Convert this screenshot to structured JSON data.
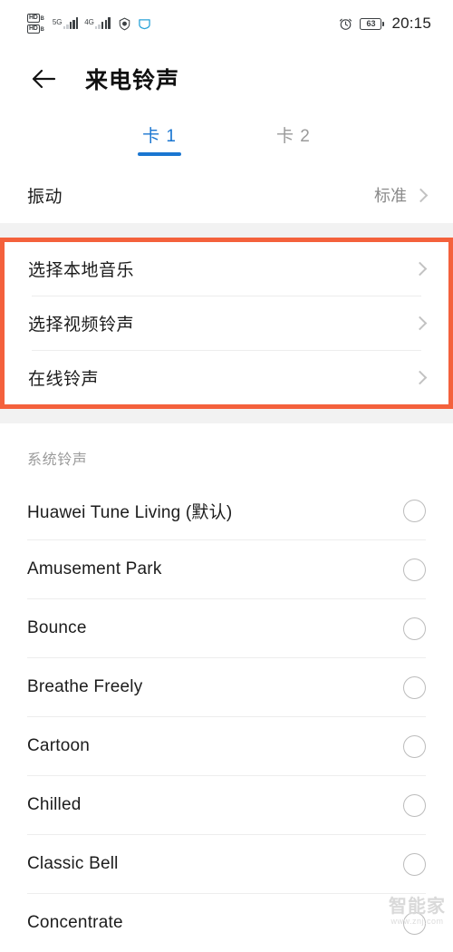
{
  "status_bar": {
    "hd_labels": [
      "HD",
      "HD"
    ],
    "hd_sub": "B",
    "network_5g": "5G",
    "network_4g": "4G",
    "alarm_icon": "alarm-clock-icon",
    "battery_level": "63",
    "time": "20:15"
  },
  "header": {
    "back_icon": "back-arrow-icon",
    "title": "来电铃声"
  },
  "tabs": [
    {
      "label": "卡 1",
      "active": true
    },
    {
      "label": "卡 2",
      "active": false
    }
  ],
  "vibration": {
    "label": "振动",
    "value": "标准",
    "chevron_icon": "chevron-right-icon"
  },
  "highlight": {
    "border_color": "#f4613c",
    "rows": [
      {
        "label": "选择本地音乐",
        "chevron_icon": "chevron-right-icon"
      },
      {
        "label": "选择视频铃声",
        "chevron_icon": "chevron-right-icon"
      },
      {
        "label": "在线铃声",
        "chevron_icon": "chevron-right-icon"
      }
    ]
  },
  "system_ringtones": {
    "section_title": "系统铃声",
    "items": [
      {
        "label": "Huawei Tune Living (默认)",
        "selected": false
      },
      {
        "label": "Amusement Park",
        "selected": false
      },
      {
        "label": "Bounce",
        "selected": false
      },
      {
        "label": "Breathe Freely",
        "selected": false
      },
      {
        "label": "Cartoon",
        "selected": false
      },
      {
        "label": "Chilled",
        "selected": false
      },
      {
        "label": "Classic Bell",
        "selected": false
      },
      {
        "label": "Concentrate",
        "selected": false
      }
    ]
  },
  "watermark": {
    "main": "智能家",
    "sub": "www.znj.com"
  },
  "colors": {
    "accent_blue": "#1a76d1",
    "highlight_orange": "#f4613c",
    "gap_grey": "#f2f2f2"
  }
}
